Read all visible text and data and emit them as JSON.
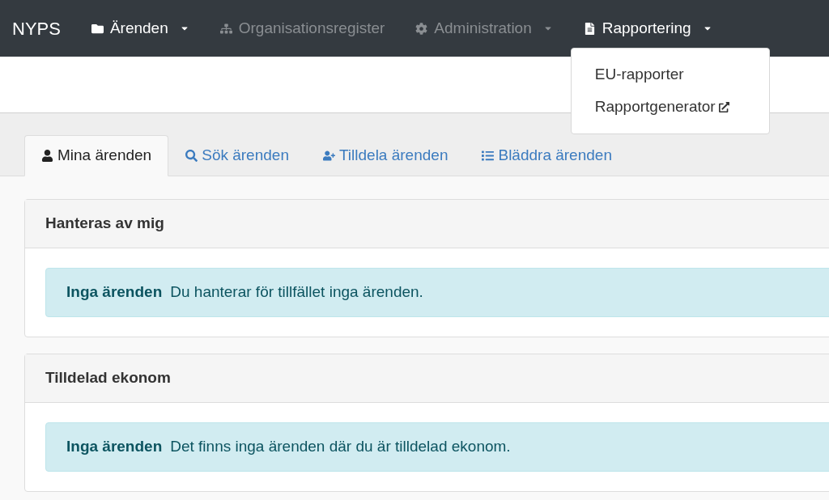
{
  "navbar": {
    "brand": "NYPS",
    "items": [
      {
        "label": "Ärenden",
        "caret": true,
        "disabled": false
      },
      {
        "label": "Organisationsregister",
        "caret": false,
        "disabled": true
      },
      {
        "label": "Administration",
        "caret": true,
        "disabled": true
      },
      {
        "label": "Rapportering",
        "caret": true,
        "disabled": false,
        "expanded": true,
        "menu": [
          {
            "label": "EU-rapporter",
            "external": false
          },
          {
            "label": "Rapportgenerator",
            "external": true
          }
        ]
      }
    ]
  },
  "tabs": [
    {
      "label": "Mina ärenden",
      "selected": true
    },
    {
      "label": "Sök ärenden",
      "selected": false
    },
    {
      "label": "Tilldela ärenden",
      "selected": false
    },
    {
      "label": "Bläddra ärenden",
      "selected": false
    }
  ],
  "panels": [
    {
      "title": "Hanteras av mig",
      "alert": {
        "heading": "Inga ärenden",
        "text": "Du hanterar för tillfället inga ärenden."
      }
    },
    {
      "title": "Tilldelad ekonom",
      "alert": {
        "heading": "Inga ärenden",
        "text": "Det finns inga ärenden där du är tilldelad ekonom."
      }
    }
  ]
}
